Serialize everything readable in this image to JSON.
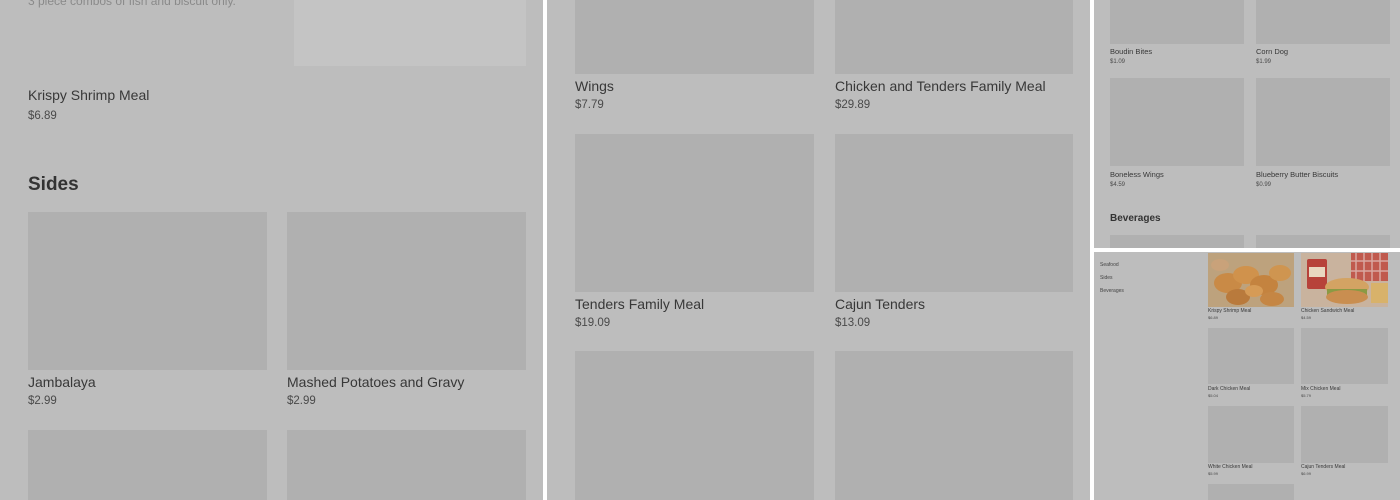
{
  "panel1": {
    "top_description": "3 piece combos of fish and biscuit only.",
    "krispy_shrimp": {
      "name": "Krispy Shrimp Meal",
      "price": "$6.89"
    },
    "sides_heading": "Sides",
    "items": [
      {
        "name": "Jambalaya",
        "price": "$2.99"
      },
      {
        "name": "Mashed Potatoes and Gravy",
        "price": "$2.99"
      }
    ]
  },
  "panel2": {
    "items": [
      {
        "name": "Wings",
        "price": "$7.79"
      },
      {
        "name": "Chicken and Tenders Family Meal",
        "price": "$29.89"
      },
      {
        "name": "Tenders Family Meal",
        "price": "$19.09"
      },
      {
        "name": "Cajun Tenders",
        "price": "$13.09"
      }
    ]
  },
  "panel3": {
    "items": [
      {
        "name": "Boudin Bites",
        "price": "$1.09"
      },
      {
        "name": "Corn Dog",
        "price": "$1.99"
      },
      {
        "name": "Boneless Wings",
        "price": "$4.59"
      },
      {
        "name": "Blueberry Butter Biscuits",
        "price": "$0.99"
      }
    ],
    "beverages_heading": "Beverages"
  },
  "panel4": {
    "nav": [
      "Seafood",
      "Sides",
      "Beverages"
    ],
    "items": [
      {
        "name": "Krispy Shrimp Meal",
        "price": "$6.89"
      },
      {
        "name": "Chicken Sandwich Meal",
        "price": "$4.59"
      },
      {
        "name": "Dark Chicken Meal",
        "price": "$5.04"
      },
      {
        "name": "Mix Chicken Meal",
        "price": "$5.79"
      },
      {
        "name": "White Chicken Meal",
        "price": "$5.99"
      },
      {
        "name": "Cajun Tenders Meal",
        "price": "$6.99"
      }
    ]
  }
}
